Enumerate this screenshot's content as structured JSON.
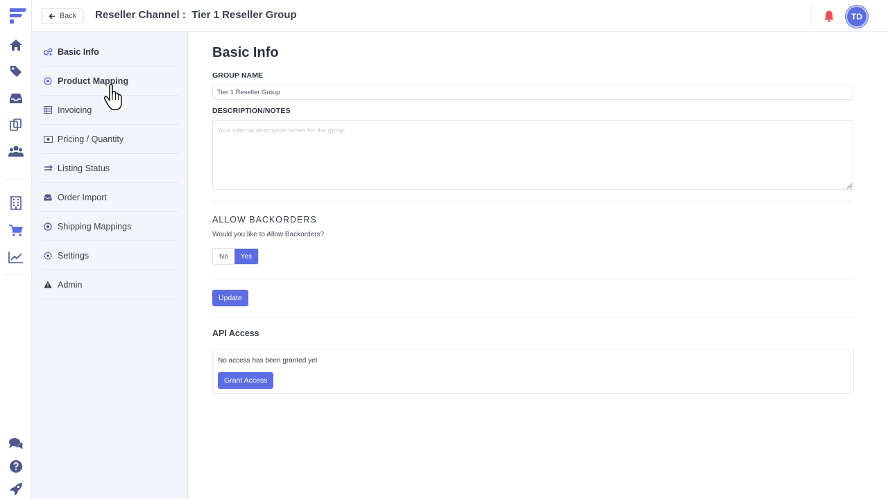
{
  "header": {
    "back_label": "Back",
    "title": "Reseller Channel :  Tier 1 Reseller Group",
    "avatar_initials": "TD"
  },
  "rail": {
    "icons": [
      "logo-icon",
      "home-icon",
      "tags-icon",
      "inbox-icon",
      "copy-icon",
      "users-icon",
      "building-icon",
      "cart-icon",
      "chart-icon",
      "chat-icon",
      "help-icon",
      "rocket-icon"
    ],
    "active": "cart-icon"
  },
  "subnav": {
    "items": [
      {
        "label": "Basic Info",
        "icon": "cogs-icon",
        "active": true
      },
      {
        "label": "Product Mapping",
        "icon": "target-icon"
      },
      {
        "label": "Invoicing",
        "icon": "table-icon"
      },
      {
        "label": "Pricing / Quantity",
        "icon": "money-icon"
      },
      {
        "label": "Listing Status",
        "icon": "exchange-icon"
      },
      {
        "label": "Order Import",
        "icon": "inbox-icon"
      },
      {
        "label": "Shipping Mappings",
        "icon": "target-icon"
      },
      {
        "label": "Settings",
        "icon": "gear-icon"
      },
      {
        "label": "Admin",
        "icon": "warning-icon"
      }
    ]
  },
  "main": {
    "section_title": "Basic Info",
    "group_name_label": "GROUP NAME",
    "group_name_value": "Tier 1 Reseller Group",
    "description_label": "DESCRIPTION/NOTES",
    "description_placeholder": "Your internal description/notes for the group",
    "backorders_title": "ALLOW BACKORDERS",
    "backorders_question": "Would you like to Allow Backorders?",
    "backorders_no": "No",
    "backorders_yes": "Yes",
    "backorders_selected": "Yes",
    "update_label": "Update",
    "api_title": "API Access",
    "api_message": "No access has been granted yet",
    "grant_label": "Grant Access"
  },
  "colors": {
    "accent": "#5b6de0",
    "nav_bg": "#f3f5fb",
    "bell": "#e8505b",
    "rail_icon": "#4b5a8a"
  }
}
